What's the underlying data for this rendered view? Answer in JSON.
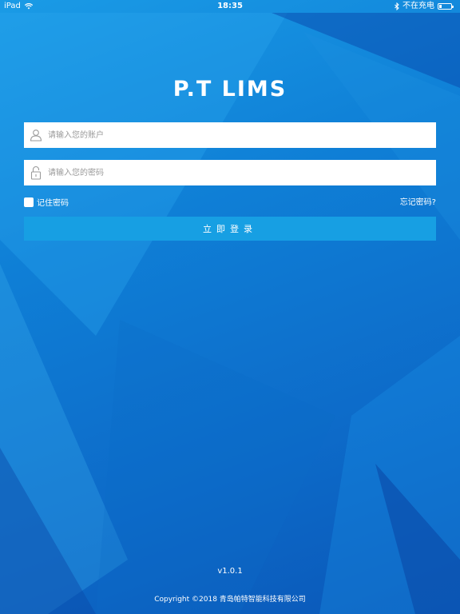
{
  "status_bar": {
    "device": "iPad",
    "time": "18:35",
    "charging_text": "不在充电"
  },
  "app": {
    "title": "P.T LIMS"
  },
  "login_form": {
    "account_placeholder": "请输入您的账户",
    "password_placeholder": "请输入您的密码",
    "remember_label": "记住密码",
    "forgot_label": "忘记密码?",
    "login_button": "立即登录"
  },
  "footer": {
    "version": "v1.0.1",
    "copyright": "Copyright ©2018 青岛帕特智能科技有限公司"
  },
  "colors": {
    "background": "#0f7fd6",
    "button": "#179fe3",
    "text": "#ffffff"
  }
}
